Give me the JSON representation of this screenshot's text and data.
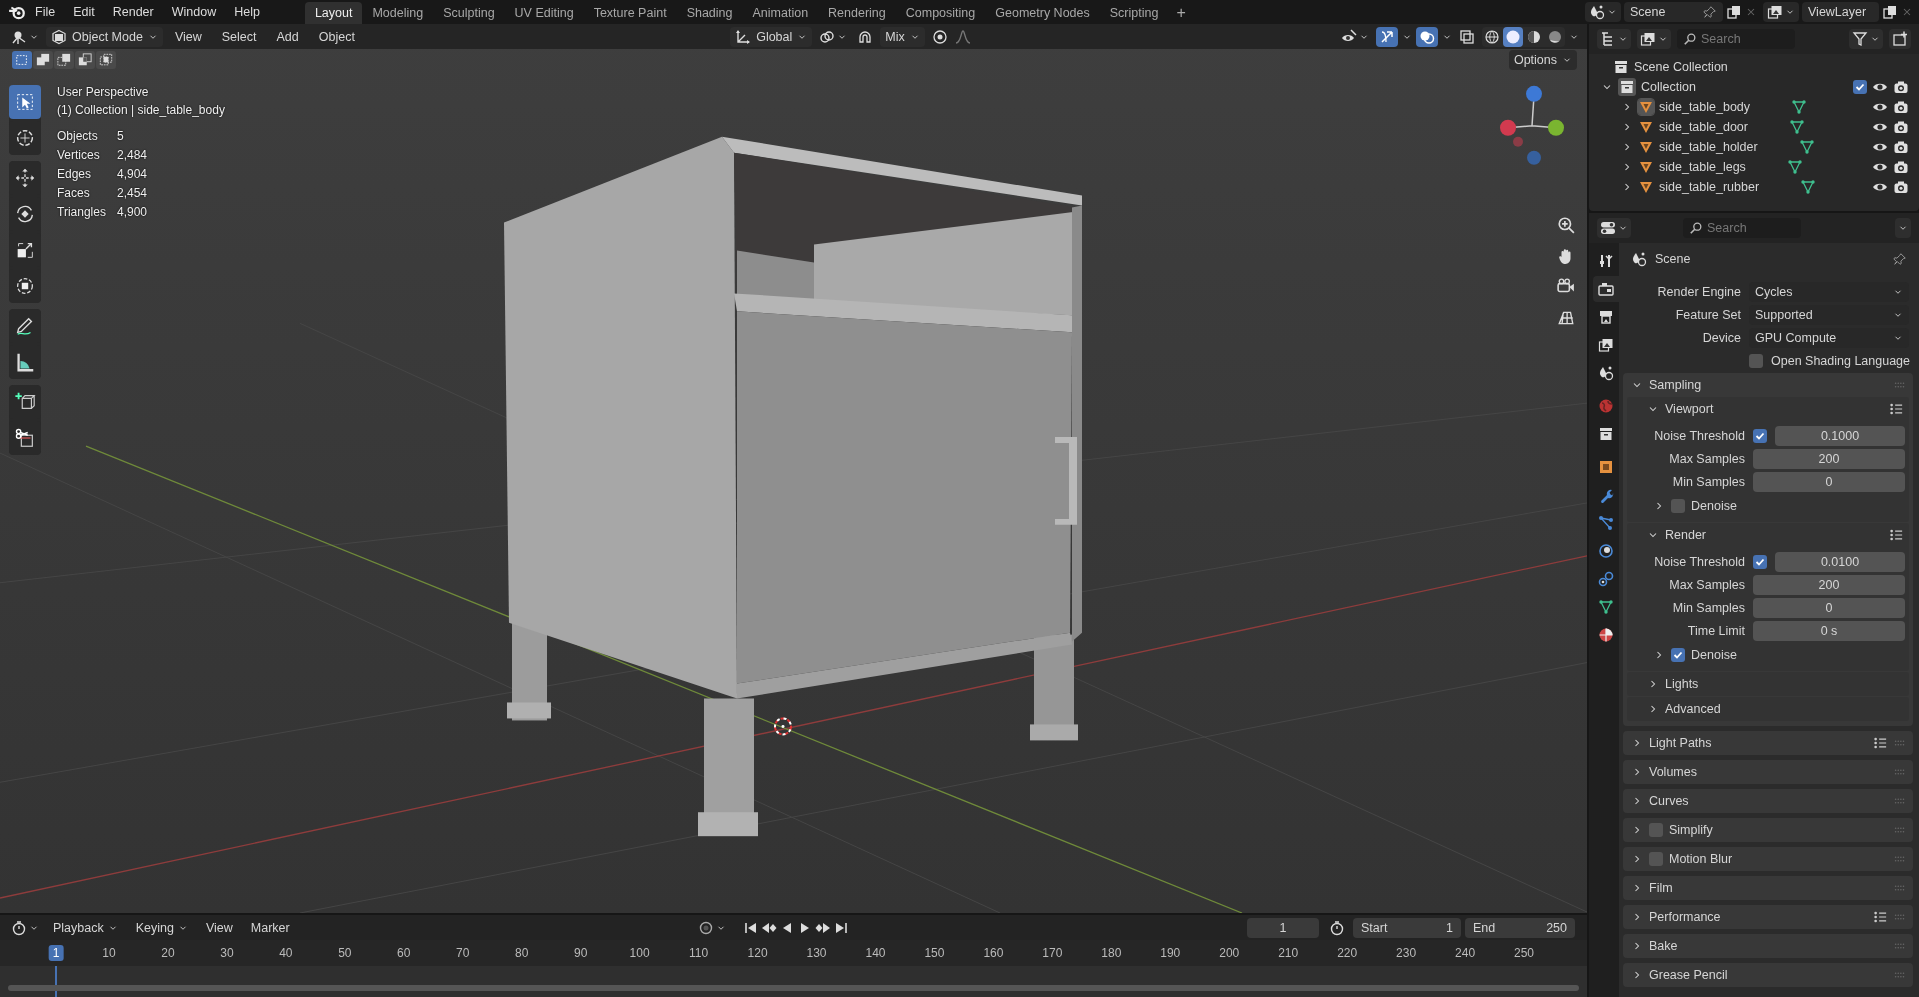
{
  "menu": [
    "File",
    "Edit",
    "Render",
    "Window",
    "Help"
  ],
  "workspaces": [
    {
      "label": "Layout",
      "selected": true
    },
    {
      "label": "Modeling",
      "selected": false
    },
    {
      "label": "Sculpting",
      "selected": false
    },
    {
      "label": "UV Editing",
      "selected": false
    },
    {
      "label": "Texture Paint",
      "selected": false
    },
    {
      "label": "Shading",
      "selected": false
    },
    {
      "label": "Animation",
      "selected": false
    },
    {
      "label": "Rendering",
      "selected": false
    },
    {
      "label": "Compositing",
      "selected": false
    },
    {
      "label": "Geometry Nodes",
      "selected": false
    },
    {
      "label": "Scripting",
      "selected": false
    }
  ],
  "add_workspace": "+",
  "scene": "Scene",
  "view_layer": "ViewLayer",
  "viewport_header": {
    "mode": "Object Mode",
    "menus": [
      "View",
      "Select",
      "Add",
      "Object"
    ],
    "orientation": "Global",
    "snap_target": "Mix",
    "options": "Options",
    "select_modes": [
      {
        "kind": "new",
        "selected": true
      },
      {
        "kind": "extend",
        "selected": false
      },
      {
        "kind": "subtract",
        "selected": false
      },
      {
        "kind": "difference",
        "selected": false
      },
      {
        "kind": "intersect",
        "selected": false
      }
    ],
    "shading": [
      {
        "kind": "wireframe",
        "selected": false
      },
      {
        "kind": "solid",
        "selected": true
      },
      {
        "kind": "material",
        "selected": false
      },
      {
        "kind": "rendered",
        "selected": false
      }
    ]
  },
  "tool_groups": [
    [
      {
        "kind": "select",
        "selected": true
      },
      {
        "kind": "cursor",
        "selected": false
      }
    ],
    [
      {
        "kind": "move",
        "selected": false
      },
      {
        "kind": "rotate",
        "selected": false
      },
      {
        "kind": "scale",
        "selected": false
      },
      {
        "kind": "transform",
        "selected": false
      }
    ],
    [
      {
        "kind": "annotate",
        "selected": false
      },
      {
        "kind": "measure",
        "selected": false
      }
    ],
    [
      {
        "kind": "add_cube",
        "selected": false
      },
      {
        "kind": "cut",
        "selected": false
      }
    ]
  ],
  "overlay": {
    "title": "User Perspective",
    "context": "(1) Collection | side_table_body",
    "stats": [
      {
        "label": "Objects",
        "value": "5"
      },
      {
        "label": "Vertices",
        "value": "2,484"
      },
      {
        "label": "Edges",
        "value": "4,904"
      },
      {
        "label": "Faces",
        "value": "2,454"
      },
      {
        "label": "Triangles",
        "value": "4,900"
      }
    ]
  },
  "outliner": {
    "search_placeholder": "Search",
    "root": "Scene Collection",
    "collection": {
      "name": "Collection",
      "expanded": true,
      "checked": true,
      "children": [
        {
          "name": "side_table_body",
          "selected": true,
          "expanded": false
        },
        {
          "name": "side_table_door",
          "selected": false,
          "expanded": false
        },
        {
          "name": "side_table_holder",
          "selected": false,
          "expanded": false
        },
        {
          "name": "side_table_legs",
          "selected": false,
          "expanded": false
        },
        {
          "name": "side_table_rubber",
          "selected": false,
          "expanded": false
        }
      ]
    }
  },
  "properties": {
    "search_placeholder": "Search",
    "context": "Scene",
    "tabs": [
      {
        "kind": "tool",
        "selected": false
      },
      {
        "kind": "render",
        "selected": true
      },
      {
        "kind": "output",
        "selected": false
      },
      {
        "kind": "view_layer",
        "selected": false
      },
      {
        "kind": "scene",
        "selected": false
      },
      {
        "kind": "world",
        "selected": false
      },
      {
        "kind": "collection",
        "selected": false
      },
      {
        "kind": "object",
        "selected": false
      },
      {
        "kind": "modifiers",
        "selected": false
      },
      {
        "kind": "particles",
        "selected": false
      },
      {
        "kind": "physics",
        "selected": false
      },
      {
        "kind": "constraints",
        "selected": false
      },
      {
        "kind": "data",
        "selected": false
      },
      {
        "kind": "material",
        "selected": false
      }
    ],
    "rows": [
      {
        "kind": "dropdown",
        "label": "Render Engine",
        "value": "Cycles"
      },
      {
        "kind": "dropdown",
        "label": "Feature Set",
        "value": "Supported"
      },
      {
        "kind": "dropdown",
        "label": "Device",
        "value": "GPU Compute"
      },
      {
        "kind": "check",
        "label": "Open Shading Language",
        "checked": false
      },
      {
        "kind": "panel",
        "label": "Sampling",
        "expanded": true,
        "children": [
          {
            "kind": "panel",
            "label": "Viewport",
            "expanded": true,
            "presets": true,
            "children": [
              {
                "kind": "field",
                "label": "Noise Threshold",
                "value": "0.1000",
                "checked": true
              },
              {
                "kind": "field",
                "label": "Max Samples",
                "value": "200"
              },
              {
                "kind": "field",
                "label": "Min Samples",
                "value": "0"
              },
              {
                "kind": "panel",
                "label": "Denoise",
                "expanded": false,
                "checked": false
              }
            ]
          },
          {
            "kind": "panel",
            "label": "Render",
            "expanded": true,
            "presets": true,
            "children": [
              {
                "kind": "field",
                "label": "Noise Threshold",
                "value": "0.0100",
                "checked": true
              },
              {
                "kind": "field",
                "label": "Max Samples",
                "value": "200"
              },
              {
                "kind": "field",
                "label": "Min Samples",
                "value": "0"
              },
              {
                "kind": "field",
                "label": "Time Limit",
                "value": "0 s"
              },
              {
                "kind": "panel",
                "label": "Denoise",
                "expanded": false,
                "checked": true
              }
            ]
          },
          {
            "kind": "panel",
            "label": "Lights",
            "expanded": false
          },
          {
            "kind": "panel",
            "label": "Advanced",
            "expanded": false
          }
        ]
      },
      {
        "kind": "panel",
        "label": "Light Paths",
        "expanded": false,
        "presets": true
      },
      {
        "kind": "panel",
        "label": "Volumes",
        "expanded": false
      },
      {
        "kind": "panel",
        "label": "Curves",
        "expanded": false
      },
      {
        "kind": "panel",
        "label": "Simplify",
        "expanded": false,
        "checked": false
      },
      {
        "kind": "panel",
        "label": "Motion Blur",
        "expanded": false,
        "checked": false
      },
      {
        "kind": "panel",
        "label": "Film",
        "expanded": false
      },
      {
        "kind": "panel",
        "label": "Performance",
        "expanded": false,
        "presets": true
      },
      {
        "kind": "panel",
        "label": "Bake",
        "expanded": false
      },
      {
        "kind": "panel",
        "label": "Grease Pencil",
        "expanded": false
      }
    ]
  },
  "timeline": {
    "menus": [
      {
        "label": "Playback",
        "dropdown": true
      },
      {
        "label": "Keying",
        "dropdown": true
      },
      {
        "label": "View",
        "dropdown": false
      },
      {
        "label": "Marker",
        "dropdown": false
      }
    ],
    "current_frame": "1",
    "start_label": "Start",
    "start": "1",
    "end_label": "End",
    "end": "250",
    "ticks": [
      {
        "label": "1",
        "selected": true
      },
      {
        "label": "10",
        "selected": false
      },
      {
        "label": "20",
        "selected": false
      },
      {
        "label": "30",
        "selected": false
      },
      {
        "label": "40",
        "selected": false
      },
      {
        "label": "50",
        "selected": false
      },
      {
        "label": "60",
        "selected": false
      },
      {
        "label": "70",
        "selected": false
      },
      {
        "label": "80",
        "selected": false
      },
      {
        "label": "90",
        "selected": false
      },
      {
        "label": "100",
        "selected": false
      },
      {
        "label": "110",
        "selected": false
      },
      {
        "label": "120",
        "selected": false
      },
      {
        "label": "130",
        "selected": false
      },
      {
        "label": "140",
        "selected": false
      },
      {
        "label": "150",
        "selected": false
      },
      {
        "label": "160",
        "selected": false
      },
      {
        "label": "170",
        "selected": false
      },
      {
        "label": "180",
        "selected": false
      },
      {
        "label": "190",
        "selected": false
      },
      {
        "label": "200",
        "selected": false
      },
      {
        "label": "210",
        "selected": false
      },
      {
        "label": "220",
        "selected": false
      },
      {
        "label": "230",
        "selected": false
      },
      {
        "label": "240",
        "selected": false
      },
      {
        "label": "250",
        "selected": false
      }
    ]
  }
}
